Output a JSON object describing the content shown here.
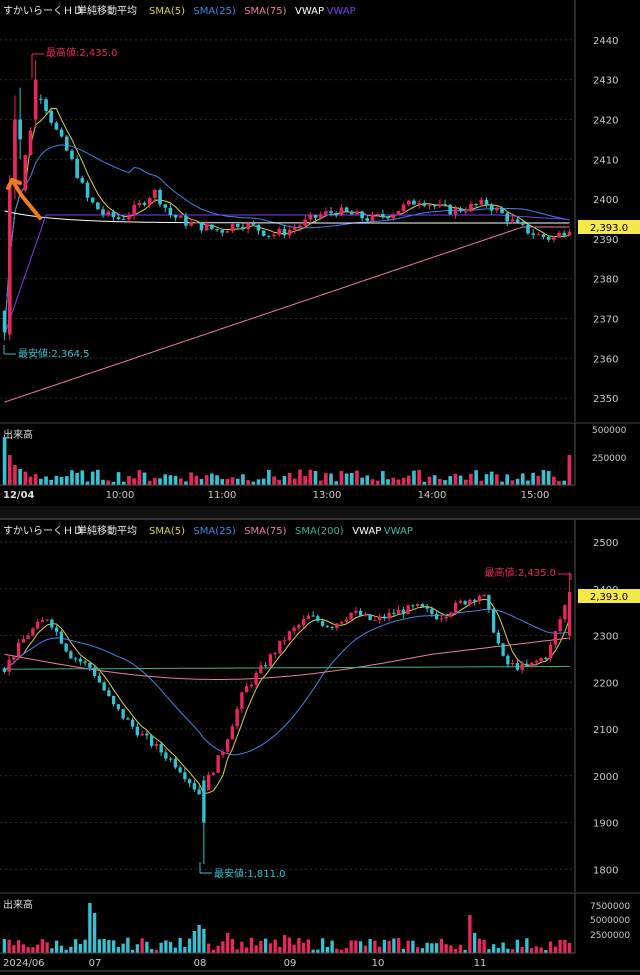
{
  "intraday": {
    "legend": {
      "name": "すかいらーくＨＤ",
      "type": "単純移動平均",
      "items": [
        {
          "label": "SMA(5)",
          "color": "#d9d24a"
        },
        {
          "label": "SMA(25)",
          "color": "#3f86e8"
        },
        {
          "label": "SMA(75)",
          "color": "#e8819a"
        },
        {
          "label": "VWAP",
          "color": "#ffffff"
        },
        {
          "label": "VWAP",
          "color": "#7a3df0"
        }
      ]
    },
    "high_label": "最高値:2,435.0",
    "low_label": "最安値:2,364.5",
    "last_price": "2,393.0",
    "volume_title": "出来高",
    "volume_ticks": [
      "500000",
      "250000"
    ],
    "date_label": "12/04",
    "time_labels": [
      "10:00",
      "11:00",
      "13:00",
      "14:00",
      "15:00"
    ]
  },
  "daily": {
    "legend": {
      "name": "すかいらーくＨＤ",
      "type": "単純移動平均",
      "items": [
        {
          "label": "SMA(5)",
          "color": "#d9d24a"
        },
        {
          "label": "SMA(25)",
          "color": "#3f86e8"
        },
        {
          "label": "SMA(75)",
          "color": "#e8819a"
        },
        {
          "label": "SMA(200)",
          "color": "#3fb48a"
        },
        {
          "label": "VWAP",
          "color": "#ffffff"
        },
        {
          "label": "VWAP",
          "color": "#2fc4a0"
        }
      ]
    },
    "high_label": "最高値:2,435.0",
    "low_label": "最安値:1,811.0",
    "last_price": "2,393.0",
    "volume_title": "出来高",
    "volume_ticks": [
      "7500000",
      "5000000",
      "2500000"
    ],
    "month_labels": [
      "2024/06",
      "07",
      "08",
      "09",
      "10",
      "11"
    ]
  },
  "colors": {
    "up": "#e8285a",
    "down": "#36c2d2",
    "grid": "#2a2a2a",
    "price_badge": "#f5e84a"
  },
  "chart_data": [
    {
      "type": "candlestick",
      "title": "",
      "ylim": [
        2345,
        2445
      ],
      "yticks": [
        2350,
        2360,
        2370,
        2380,
        2390,
        2400,
        2410,
        2420,
        2430,
        2440
      ],
      "x": [
        "09:00",
        "09:10",
        "09:20",
        "09:30",
        "09:40",
        "09:50",
        "10:00",
        "10:10",
        "10:20",
        "10:30",
        "10:40",
        "10:50",
        "11:00",
        "11:10",
        "11:20",
        "11:30",
        "12:30",
        "12:40",
        "12:50",
        "13:00",
        "13:10",
        "13:20",
        "13:30",
        "13:40",
        "13:50",
        "14:00",
        "14:10",
        "14:20",
        "14:30",
        "14:40",
        "14:50",
        "15:00",
        "15:10",
        "15:20",
        "15:25"
      ],
      "close": [
        2364.5,
        2405,
        2428,
        2418,
        2410,
        2400,
        2396,
        2395,
        2398,
        2402,
        2396,
        2394,
        2393,
        2392,
        2394,
        2393,
        2391,
        2392,
        2394,
        2396,
        2397,
        2396,
        2395,
        2396,
        2398,
        2400,
        2398,
        2397,
        2398,
        2399,
        2396,
        2393,
        2391,
        2390,
        2393.0
      ],
      "high": 2435.0,
      "low": 2364.5,
      "last": 2393.0
    },
    {
      "type": "candlestick",
      "title": "",
      "ylim": [
        1760,
        2530
      ],
      "yticks": [
        1800,
        1900,
        2000,
        2100,
        2200,
        2300,
        2400,
        2500
      ],
      "x": [
        "2024-06-03",
        "2024-06-10",
        "2024-06-17",
        "2024-06-24",
        "2024-07-01",
        "2024-07-08",
        "2024-07-15",
        "2024-07-22",
        "2024-07-29",
        "2024-08-05",
        "2024-08-12",
        "2024-08-19",
        "2024-08-26",
        "2024-09-02",
        "2024-09-09",
        "2024-09-16",
        "2024-09-24",
        "2024-09-30",
        "2024-10-07",
        "2024-10-15",
        "2024-10-21",
        "2024-10-28",
        "2024-11-05",
        "2024-11-11",
        "2024-11-18",
        "2024-11-25",
        "2024-12-02"
      ],
      "close": [
        2230,
        2300,
        2340,
        2260,
        2230,
        2150,
        2100,
        2060,
        2020,
        1960,
        2050,
        2180,
        2240,
        2300,
        2340,
        2320,
        2350,
        2330,
        2350,
        2360,
        2340,
        2370,
        2390,
        2240,
        2230,
        2260,
        2393
      ],
      "high": 2435.0,
      "low": 1811.0,
      "last": 2393.0
    }
  ]
}
